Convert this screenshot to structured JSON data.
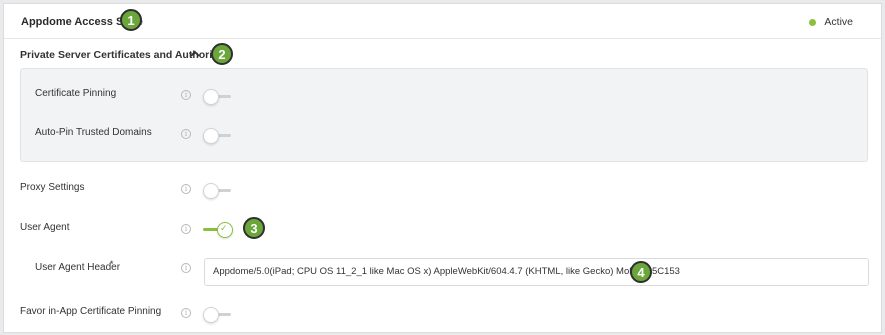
{
  "header": {
    "title": "Appdome Access Suite",
    "status": "Active"
  },
  "section": {
    "title": "Private Server Certificates and Authorities",
    "chevron": "chevron-up-icon"
  },
  "settings": {
    "certificate_pinning": {
      "label": "Certificate Pinning",
      "enabled": false
    },
    "auto_pin": {
      "label": "Auto-Pin Trusted Domains",
      "enabled": false
    },
    "proxy": {
      "label": "Proxy Settings",
      "enabled": false
    },
    "user_agent": {
      "label": "User Agent",
      "enabled": true
    },
    "user_agent_header": {
      "label": "User Agent Header",
      "required_mark": "*",
      "value": "Appdome/5.0(iPad; CPU OS 11_2_1 like Mac OS x) AppleWebKit/604.4.7 (KHTML, like Gecko) Mobile/15C153"
    },
    "favor_in_app": {
      "label": "Favor in-App Certificate Pinning",
      "enabled": false
    }
  },
  "badges": [
    "1",
    "2",
    "3",
    "4"
  ],
  "info_glyph": "i",
  "check_glyph": "✓",
  "colors": {
    "accent": "#8cbf3f",
    "badge": "#6aa63a"
  }
}
